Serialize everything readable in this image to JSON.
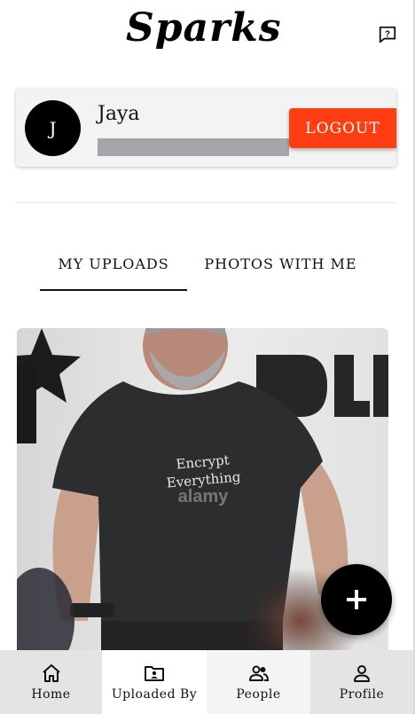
{
  "header": {
    "logo_text": "Sparks",
    "help_icon": "feedback-icon"
  },
  "profile": {
    "avatar_initial": "J",
    "name": "Jaya",
    "logout_label": "LOGOUT"
  },
  "tabs": [
    {
      "label": "MY UPLOADS",
      "selected": true
    },
    {
      "label": "PHOTOS WITH ME",
      "selected": false
    }
  ],
  "photo": {
    "shirt_text_line1": "Encrypt",
    "shirt_text_line2": "Everything",
    "watermark": "alamy"
  },
  "fab": {
    "icon": "plus-icon",
    "label": "+"
  },
  "bottom_nav": [
    {
      "label": "Home",
      "icon": "home-icon"
    },
    {
      "label": "Uploaded By",
      "icon": "folder-user-icon"
    },
    {
      "label": "People",
      "icon": "people-icon"
    },
    {
      "label": "Profile",
      "icon": "person-icon"
    }
  ],
  "colors": {
    "accent": "#ff3d12",
    "dark": "#000000",
    "card_bg": "#f3f3f3",
    "nav_bg": "#f4f4f4"
  }
}
